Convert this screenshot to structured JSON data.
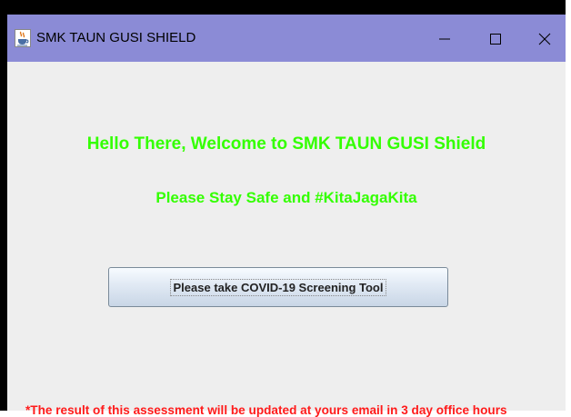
{
  "window": {
    "title": "SMK TAUN GUSI SHIELD",
    "icon": "java-cup-icon",
    "titlebar_color": "#8b8bd6",
    "controls": [
      "minimize-icon",
      "maximize-icon",
      "close-icon"
    ]
  },
  "main": {
    "welcome_text": "Hello There, Welcome to SMK TAUN GUSI Shield",
    "stay_safe_text": "Please Stay Safe and #KitaJagaKita",
    "screening_button_label": "Please take COVID-19 Screening Tool",
    "note_text": "*The result of this assessment will be updated at yours email in 3 day office hours"
  },
  "colors": {
    "greeting": "#33ff00",
    "note": "#ff1a1a",
    "background": "#eeeeee"
  }
}
